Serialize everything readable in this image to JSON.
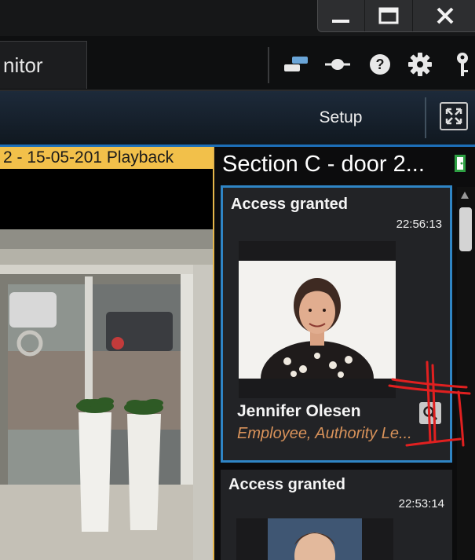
{
  "header": {
    "tab_label": "nitor",
    "icons": [
      "window-pair-icon",
      "plug-icon",
      "help-icon",
      "gear-icon",
      "key-icon"
    ]
  },
  "window_controls": [
    "minimize-icon",
    "maximize-icon",
    "close-icon"
  ],
  "toolbar": {
    "setup_label": "Setup",
    "fullscreen_icon": "fullscreen-icon"
  },
  "video": {
    "playback_label": "2 - 15-05-201 Playback",
    "accent_color": "#f2c04a"
  },
  "access_panel": {
    "title": "Section C - door 2...",
    "door_icon": "door-icon",
    "accent_color": "#2f85c5",
    "events": [
      {
        "status": "Access granted",
        "time": "22:56:13",
        "name": "Jennifer Olesen",
        "role": "Employee, Authority Le..."
      },
      {
        "status": "Access granted",
        "time": "22:53:14"
      }
    ]
  }
}
